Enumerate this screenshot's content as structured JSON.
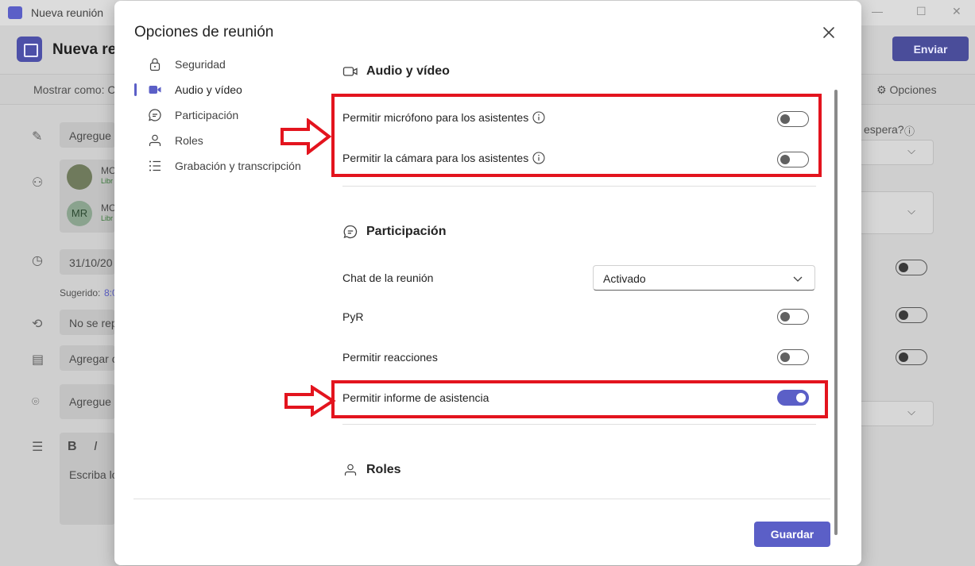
{
  "window": {
    "title": "Nueva reunión"
  },
  "background": {
    "meeting_title": "Nueva reu",
    "send_label": "Enviar",
    "show_as": "Mostrar como: C",
    "options_label": "Opciones",
    "title_field": "Agregue",
    "attendee1": "MC",
    "attendee1_sub": "Libr",
    "attendee2_initials": "MR",
    "attendee2": "MC",
    "attendee2_sub": "Libr",
    "date": "31/10/20",
    "suggested_label": "Sugerido:",
    "suggested_value": "8:0",
    "repeat": "No se rep",
    "channel": "Agregar c",
    "location": "Agregue",
    "bold": "B",
    "italic": "I",
    "body_placeholder": "Escriba lo",
    "lobby_question": "espera?"
  },
  "dialog": {
    "title": "Opciones de reunión",
    "nav": [
      {
        "label": "Seguridad",
        "icon": "lock-icon"
      },
      {
        "label": "Audio y vídeo",
        "icon": "video-camera-icon",
        "active": true
      },
      {
        "label": "Participación",
        "icon": "chat-icon"
      },
      {
        "label": "Roles",
        "icon": "person-icon"
      },
      {
        "label": "Grabación y transcripción",
        "icon": "list-icon"
      }
    ],
    "audio_video": {
      "title": "Audio y vídeo",
      "mic_label": "Permitir micrófono para los asistentes",
      "mic_enabled": false,
      "camera_label": "Permitir la cámara para los asistentes",
      "camera_enabled": false
    },
    "participation": {
      "title": "Participación",
      "chat_label": "Chat de la reunión",
      "chat_value": "Activado",
      "qna_label": "PyR",
      "qna_enabled": false,
      "reactions_label": "Permitir reacciones",
      "reactions_enabled": false,
      "attendance_label": "Permitir informe de asistencia",
      "attendance_enabled": true
    },
    "roles": {
      "title": "Roles"
    },
    "save_label": "Guardar"
  },
  "colors": {
    "accent": "#5b5fc7",
    "highlight": "#e3141e"
  }
}
